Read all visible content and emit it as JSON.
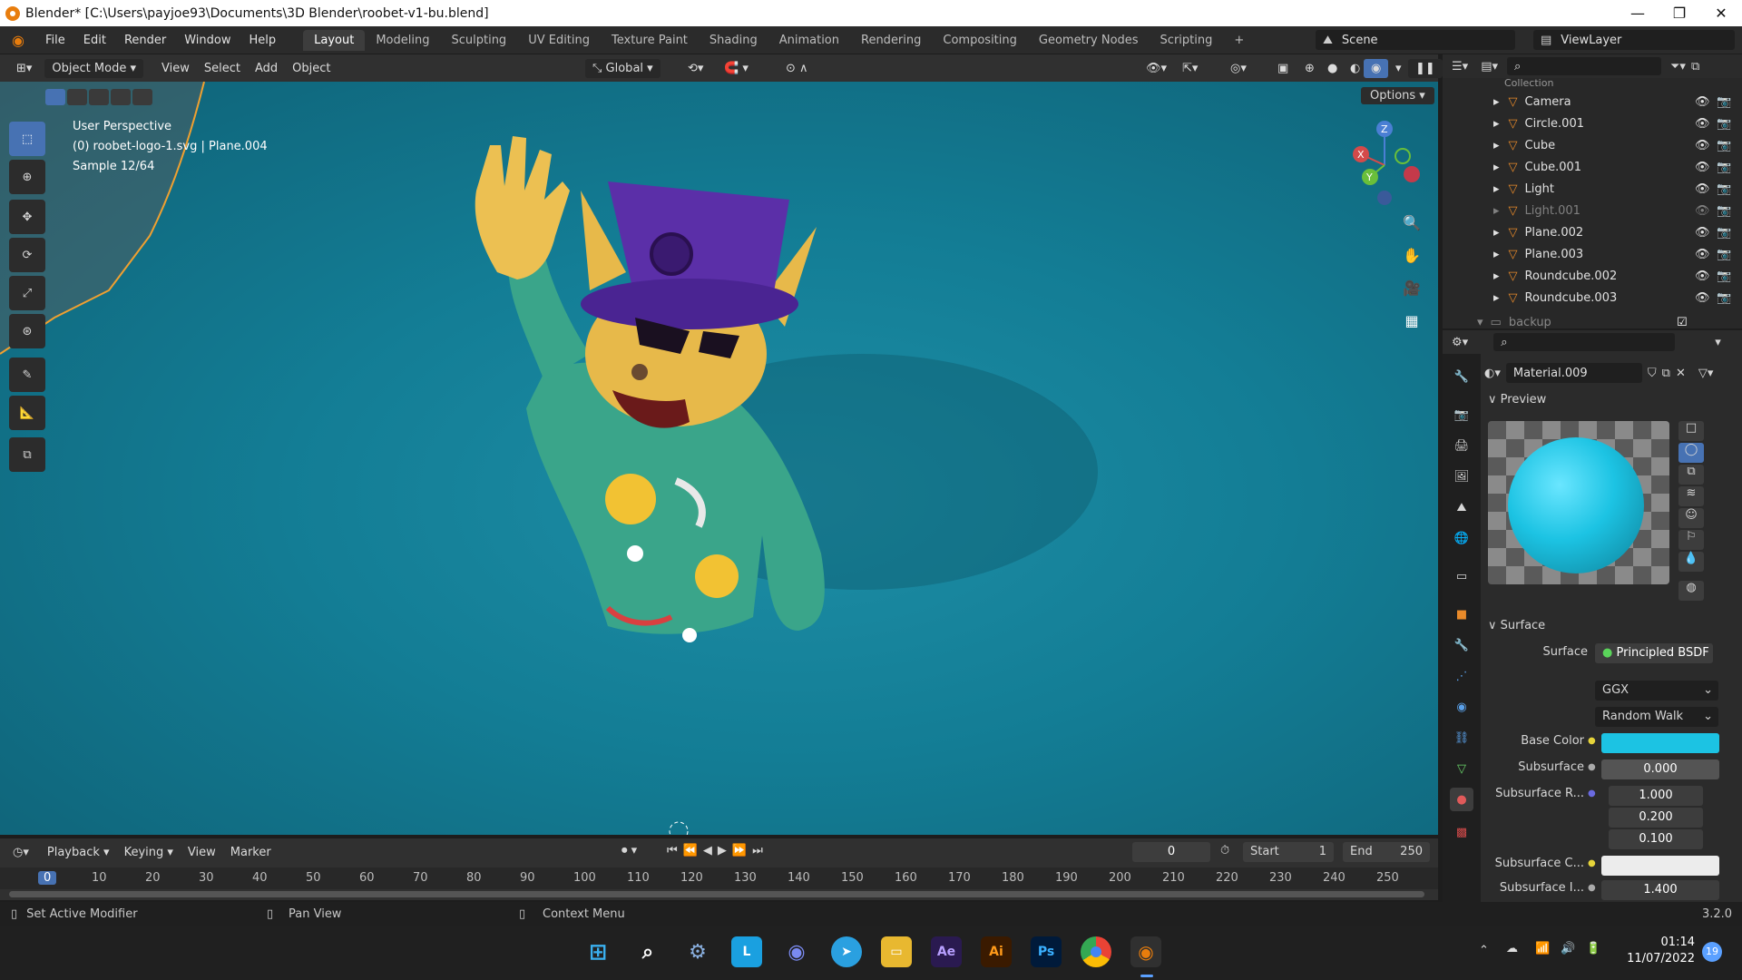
{
  "window": {
    "title": "Blender* [C:\\Users\\payjoe93\\Documents\\3D Blender\\roobet-v1-bu.blend]"
  },
  "menu": [
    "File",
    "Edit",
    "Render",
    "Window",
    "Help"
  ],
  "workspaces": [
    "Layout",
    "Modeling",
    "Sculpting",
    "UV Editing",
    "Texture Paint",
    "Shading",
    "Animation",
    "Rendering",
    "Compositing",
    "Geometry Nodes",
    "Scripting"
  ],
  "active_workspace": "Layout",
  "scene": "Scene",
  "view_layer": "ViewLayer",
  "viewport_header": {
    "mode": "Object Mode",
    "menus": [
      "View",
      "Select",
      "Add",
      "Object"
    ],
    "transform": "Global",
    "options": "Options"
  },
  "overlay_text": {
    "perspective": "User Perspective",
    "object": "(0) roobet-logo-1.svg | Plane.004",
    "sample": "Sample 12/64"
  },
  "outliner": {
    "header": "Collection",
    "items": [
      {
        "name": "Camera",
        "dim": false
      },
      {
        "name": "Circle.001",
        "dim": false
      },
      {
        "name": "Cube",
        "dim": false
      },
      {
        "name": "Cube.001",
        "dim": false
      },
      {
        "name": "Light",
        "dim": false
      },
      {
        "name": "Light.001",
        "dim": true
      },
      {
        "name": "Plane.002",
        "dim": false
      },
      {
        "name": "Plane.003",
        "dim": false
      },
      {
        "name": "Roundcube.002",
        "dim": false
      },
      {
        "name": "Roundcube.003",
        "dim": false
      }
    ],
    "footer": "backup"
  },
  "properties": {
    "material": "Material.009",
    "preview_label": "Preview",
    "surface_label": "Surface",
    "surface_field": "Surface",
    "surface_value": "Principled BSDF",
    "distribution": "GGX",
    "subsurface_method": "Random Walk",
    "base_color_label": "Base Color",
    "base_color": "#1cc3e3",
    "subsurface_label": "Subsurface",
    "subsurface_value": "0.000",
    "subsurface_r_label": "Subsurface R...",
    "subsurface_r": [
      "1.000",
      "0.200",
      "0.100"
    ],
    "subsurface_c_label": "Subsurface C...",
    "subsurface_c_color": "#ececec",
    "subsurface_i_label": "Subsurface I...",
    "subsurface_i_value": "1.400"
  },
  "timeline": {
    "menus": [
      "Playback",
      "Keying",
      "View",
      "Marker"
    ],
    "current_frame": "0",
    "start_label": "Start",
    "start": "1",
    "end_label": "End",
    "end": "250",
    "ticks": [
      "0",
      "10",
      "20",
      "30",
      "40",
      "50",
      "60",
      "70",
      "80",
      "90",
      "100",
      "110",
      "120",
      "130",
      "140",
      "150",
      "160",
      "170",
      "180",
      "190",
      "200",
      "210",
      "220",
      "230",
      "240",
      "250"
    ]
  },
  "status": {
    "left": "Set Active Modifier",
    "mid": "Pan View",
    "right": "Context Menu",
    "version": "3.2.0"
  },
  "taskbar": {
    "time": "01:14",
    "date": "11/07/2022",
    "badge": "19",
    "apps": [
      "windows-start",
      "search",
      "settings",
      "L",
      "discord",
      "telegram",
      "explorer",
      "Ae",
      "Ai",
      "Ps",
      "chrome",
      "blender"
    ]
  }
}
